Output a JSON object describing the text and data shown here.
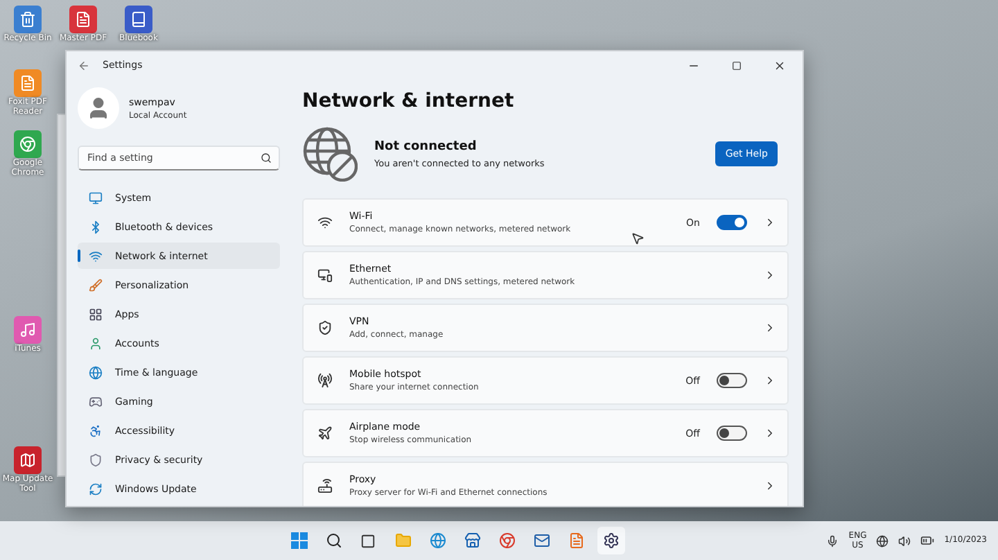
{
  "desktop_icons": [
    {
      "label": "Recycle Bin",
      "color": "#3b7fd0"
    },
    {
      "label": "Master PDF",
      "color": "#d8343c"
    },
    {
      "label": "Bluebook",
      "color": "#3a5cc8"
    },
    {
      "label": "Foxit PDF Reader",
      "color": "#f08a24"
    },
    {
      "label": "Google Chrome",
      "color": "#2fa84f"
    },
    {
      "label": "iTunes",
      "color": "#e05ab0"
    },
    {
      "label": "Map Update Tool",
      "color": "#c8232c"
    }
  ],
  "window": {
    "title": "Settings"
  },
  "profile": {
    "name": "swempav",
    "account": "Local Account"
  },
  "search": {
    "placeholder": "Find a setting"
  },
  "sidebar": {
    "items": [
      {
        "label": "System",
        "selected": false
      },
      {
        "label": "Bluetooth & devices",
        "selected": false
      },
      {
        "label": "Network & internet",
        "selected": true
      },
      {
        "label": "Personalization",
        "selected": false
      },
      {
        "label": "Apps",
        "selected": false
      },
      {
        "label": "Accounts",
        "selected": false
      },
      {
        "label": "Time & language",
        "selected": false
      },
      {
        "label": "Gaming",
        "selected": false
      },
      {
        "label": "Accessibility",
        "selected": false
      },
      {
        "label": "Privacy & security",
        "selected": false
      },
      {
        "label": "Windows Update",
        "selected": false
      }
    ]
  },
  "page": {
    "title": "Network & internet"
  },
  "status": {
    "title": "Not connected",
    "subtitle": "You aren't connected to any networks",
    "button": "Get Help"
  },
  "rows": [
    {
      "kind": "toggle",
      "title": "Wi-Fi",
      "subtitle": "Connect, manage known networks, metered network",
      "state_label": "On",
      "on": true
    },
    {
      "kind": "link",
      "title": "Ethernet",
      "subtitle": "Authentication, IP and DNS settings, metered network"
    },
    {
      "kind": "link",
      "title": "VPN",
      "subtitle": "Add, connect, manage"
    },
    {
      "kind": "toggle",
      "title": "Mobile hotspot",
      "subtitle": "Share your internet connection",
      "state_label": "Off",
      "on": false
    },
    {
      "kind": "toggle",
      "title": "Airplane mode",
      "subtitle": "Stop wireless communication",
      "state_label": "Off",
      "on": false
    },
    {
      "kind": "link",
      "title": "Proxy",
      "subtitle": "Proxy server for Wi-Fi and Ethernet connections"
    }
  ],
  "taskbar": {
    "language": "ENG",
    "region": "US",
    "date": "1/10/2023"
  }
}
